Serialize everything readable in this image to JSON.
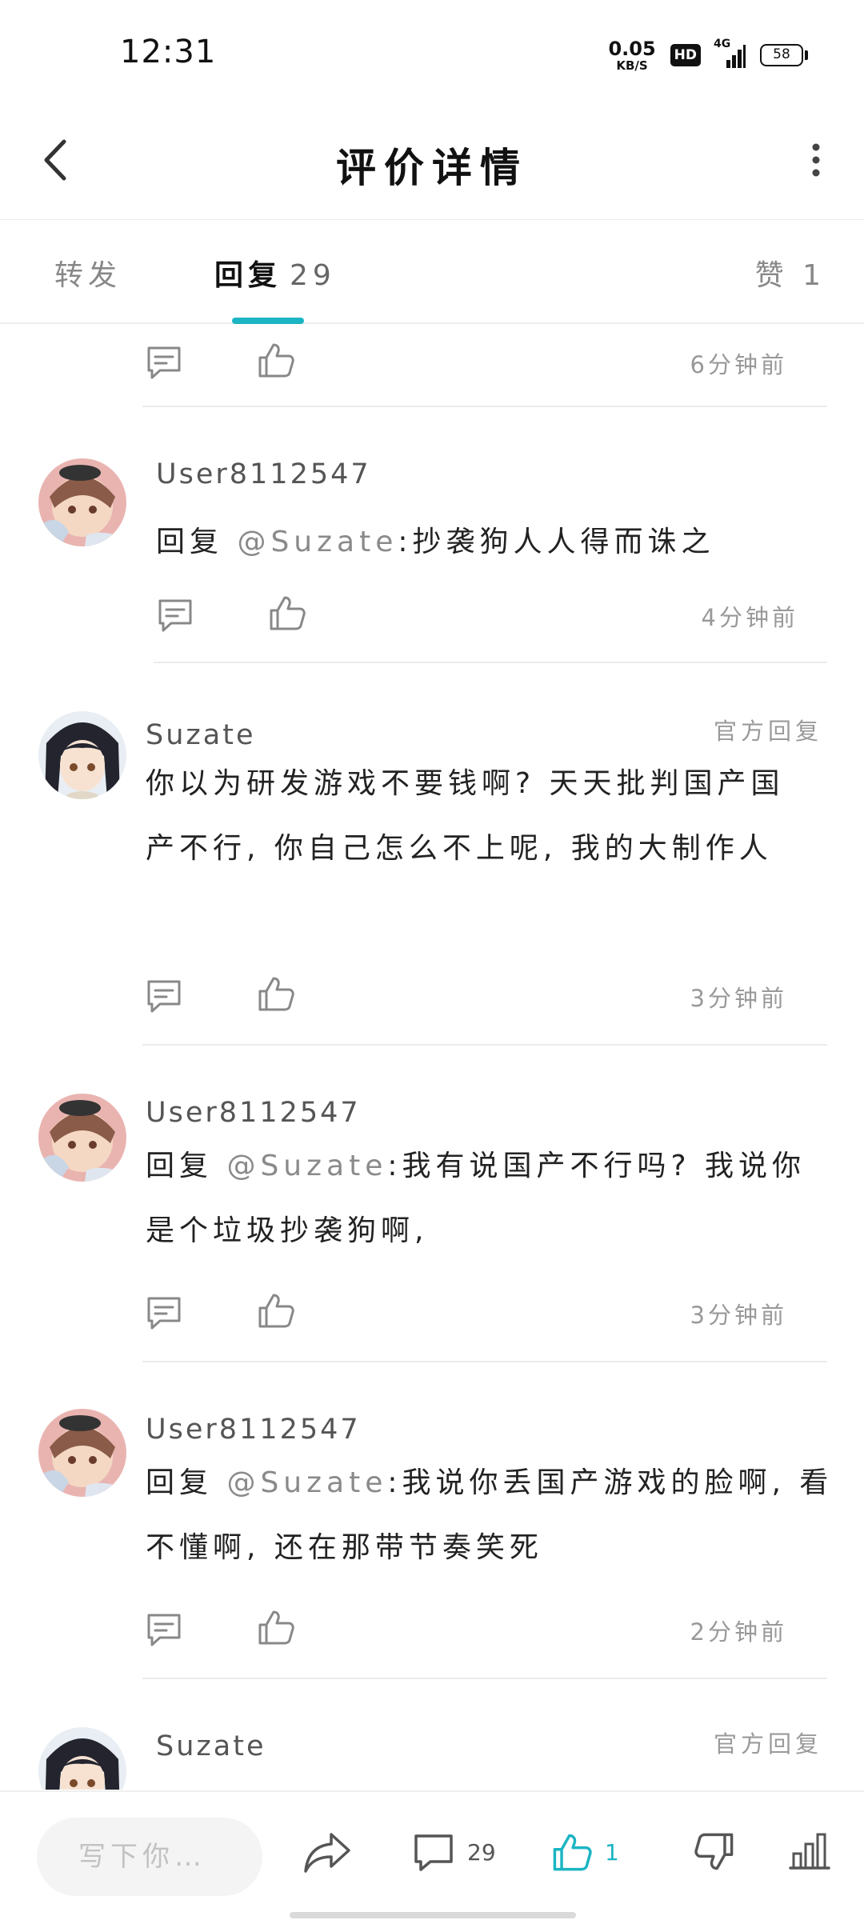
{
  "status_bar": {
    "time": "12:31",
    "net_speed_value": "0.05",
    "net_speed_unit": "KB/S",
    "hd_badge": "HD",
    "network": "4G",
    "battery": "58"
  },
  "header": {
    "title": "评价详情",
    "back_icon": "chevron-left-icon",
    "more_icon": "more-vertical-icon"
  },
  "tabs": {
    "forward": "转发",
    "reply": "回复",
    "reply_count": "29",
    "like": "赞",
    "like_count": "1",
    "active": "reply",
    "accent": "#1bb5c3"
  },
  "comments": [
    {
      "user": "",
      "official": "",
      "reply_prefix": "",
      "mention": "",
      "text": "",
      "time": "6分钟前"
    },
    {
      "user": "User8112547",
      "official": "",
      "reply_prefix": "回复 ",
      "mention": "@Suzate",
      "text": ":抄袭狗人人得而诛之",
      "time": "4分钟前"
    },
    {
      "user": "Suzate",
      "official": "官方回复",
      "reply_prefix": "",
      "mention": "",
      "text": "你以为研发游戏不要钱啊? 天天批判国产国产不行, 你自己怎么不上呢, 我的大制作人",
      "time": "3分钟前"
    },
    {
      "user": "User8112547",
      "official": "",
      "reply_prefix": "回复 ",
      "mention": "@Suzate",
      "text": ":我有说国产不行吗? 我说你是个垃圾抄袭狗啊,",
      "time": "3分钟前"
    },
    {
      "user": "User8112547",
      "official": "",
      "reply_prefix": "回复 ",
      "mention": "@Suzate",
      "text": ":我说你丢国产游戏的脸啊, 看不懂啊, 还在那带节奏笑死",
      "time": "2分钟前"
    },
    {
      "user": "Suzate",
      "official": "官方回复",
      "reply_prefix": "",
      "mention": "",
      "text": "",
      "time": ""
    }
  ],
  "bottom_bar": {
    "compose_placeholder": "写下你…",
    "comment_count": "29",
    "like_count": "1",
    "like_color": "#1bb5c3",
    "icons": [
      "share-icon",
      "comment-icon",
      "like-icon",
      "dislike-icon",
      "stats-icon"
    ]
  }
}
